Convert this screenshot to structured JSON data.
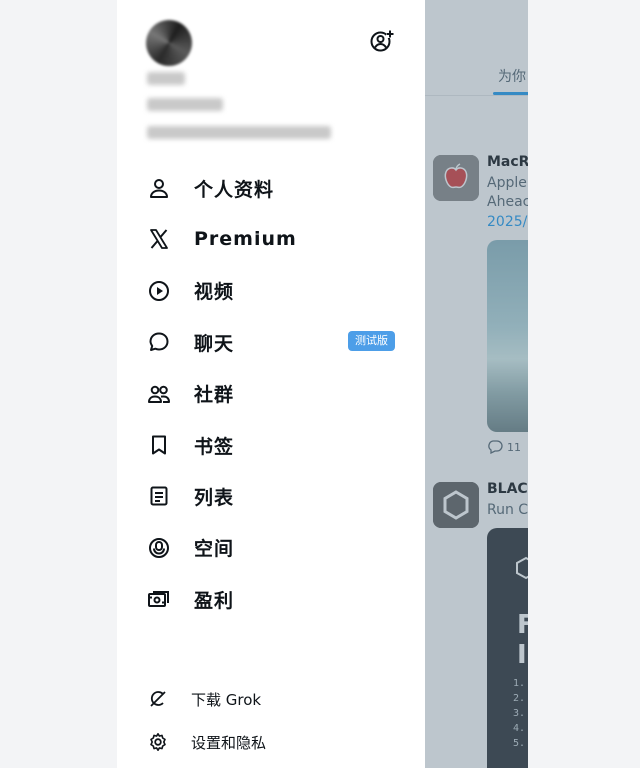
{
  "drawer": {
    "menu": [
      {
        "key": "profile",
        "label": "个人资料",
        "icon": "person-icon"
      },
      {
        "key": "premium",
        "label": "Premium",
        "icon": "x-logo-icon"
      },
      {
        "key": "video",
        "label": "视频",
        "icon": "play-circle-icon"
      },
      {
        "key": "chat",
        "label": "聊天",
        "icon": "chat-bubble-icon",
        "badge": "测试版"
      },
      {
        "key": "communities",
        "label": "社群",
        "icon": "people-icon"
      },
      {
        "key": "bookmarks",
        "label": "书签",
        "icon": "bookmark-icon"
      },
      {
        "key": "lists",
        "label": "列表",
        "icon": "list-icon"
      },
      {
        "key": "spaces",
        "label": "空间",
        "icon": "spaces-mic-icon"
      },
      {
        "key": "monetization",
        "label": "盈利",
        "icon": "money-icon"
      }
    ],
    "bottom": [
      {
        "key": "grok",
        "label": "下载 Grok",
        "icon": "grok-icon"
      },
      {
        "key": "settings",
        "label": "设置和隐私",
        "icon": "gear-icon"
      }
    ]
  },
  "feed": {
    "tab": "为你",
    "posts": [
      {
        "author": "MacR",
        "lines": [
          "Apple",
          "Aheac"
        ],
        "link": "2025/",
        "reply_count": "11"
      },
      {
        "author": "BLAC",
        "lines": [
          "Run C"
        ],
        "media_big": [
          "F",
          "IS"
        ],
        "media_list": [
          "1.",
          "2.",
          "3.",
          "4.",
          "5."
        ]
      }
    ]
  },
  "colors": {
    "accent": "#1d9bf0",
    "badge": "#4d9ee8",
    "text": "#0f1419",
    "muted": "#536471"
  }
}
